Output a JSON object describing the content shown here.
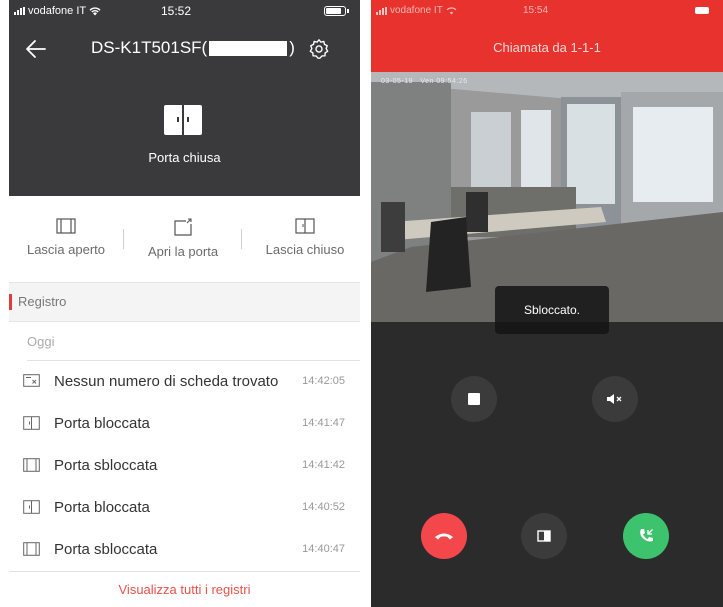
{
  "left": {
    "status": {
      "carrier": "vodafone IT",
      "time": "15:52"
    },
    "header": {
      "title_prefix": "DS-K1T501SF(",
      "title_suffix": ")"
    },
    "door": {
      "status": "Porta chiusa"
    },
    "actions": [
      {
        "label": "Lascia aperto",
        "icon": "door-open-hold-icon"
      },
      {
        "label": "Apri la porta",
        "icon": "door-open-icon"
      },
      {
        "label": "Lascia chiuso",
        "icon": "door-closed-hold-icon"
      }
    ],
    "log": {
      "section_title": "Registro",
      "group_label": "Oggi",
      "rows": [
        {
          "label": "Nessun numero di scheda trovato",
          "time": "14:42:05",
          "icon": "card-not-found-icon"
        },
        {
          "label": "Porta bloccata",
          "time": "14:41:47",
          "icon": "door-locked-icon"
        },
        {
          "label": "Porta sbloccata",
          "time": "14:41:42",
          "icon": "door-unlocked-icon"
        },
        {
          "label": "Porta bloccata",
          "time": "14:40:52",
          "icon": "door-locked-icon"
        },
        {
          "label": "Porta sbloccata",
          "time": "14:40:47",
          "icon": "door-unlocked-icon"
        }
      ],
      "view_all": "Visualizza tutti i registri"
    }
  },
  "right": {
    "status": {
      "carrier": "vodafone IT",
      "time": "15:54"
    },
    "title": "Chiamata da 1-1-1",
    "video_osd": {
      "date": "03-05-19",
      "time": "Ven 09:54:26"
    },
    "toast": "Sbloccato.",
    "buttons": {
      "stop": "stop-icon",
      "mute": "speaker-mute-icon",
      "hangup": "hang-up-icon",
      "unlock": "door-unlock-icon",
      "answer": "answer-call-icon"
    },
    "colors": {
      "header": "#e8322e",
      "hangup": "#f4474c",
      "answer": "#3dc36d"
    }
  }
}
